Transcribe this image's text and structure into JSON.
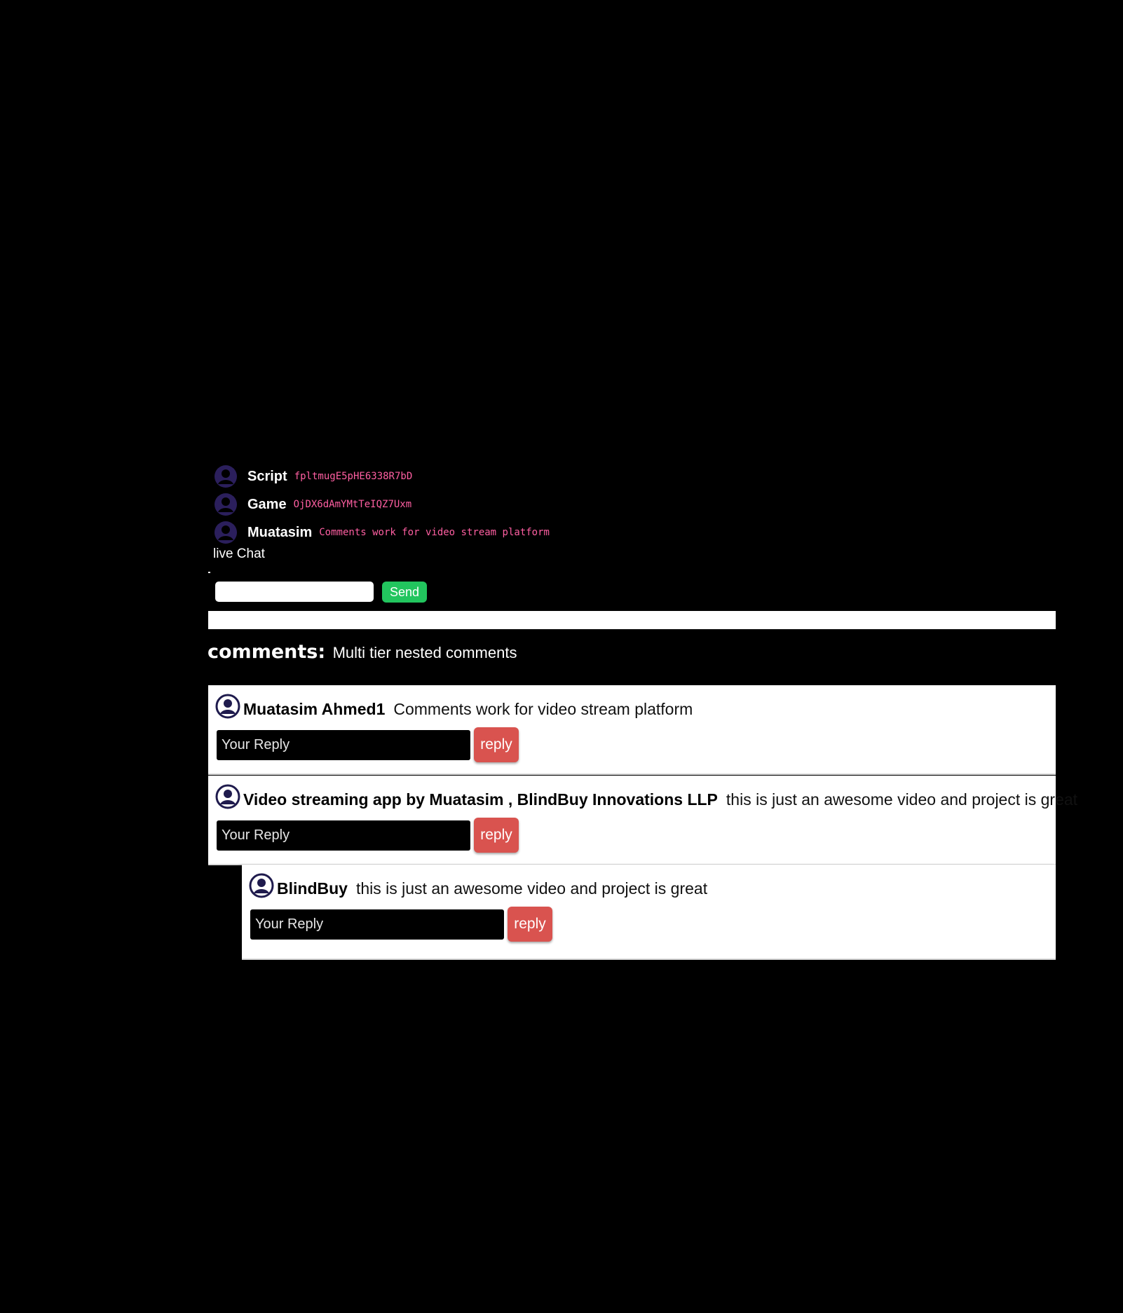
{
  "live_chat": {
    "messages": [
      {
        "user": "Script",
        "text": "fpltmugE5pHE6338R7bD",
        "avatar_icon": "user-circle-icon"
      },
      {
        "user": "Game",
        "text": "OjDX6dAmYMtTeIQZ7Uxm",
        "avatar_icon": "user-circle-icon"
      },
      {
        "user": "Muatasim",
        "text": "Comments work for video stream platform",
        "avatar_icon": "user-circle-icon"
      }
    ],
    "title": "live Chat",
    "input_value": "",
    "send_label": "Send"
  },
  "comments": {
    "heading_label": "comments:",
    "heading_text": "Multi tier nested comments",
    "items": [
      {
        "author": "Muatasim Ahmed1",
        "text": "Comments work for video stream platform",
        "reply_placeholder": "Your Reply",
        "reply_label": "reply",
        "depth": 0
      },
      {
        "author": "Video streaming app by Muatasim , BlindBuy Innovations LLP",
        "text": "this is just an awesome video and project is great",
        "reply_placeholder": "Your Reply",
        "reply_label": "reply",
        "depth": 0
      },
      {
        "author": "BlindBuy",
        "text": "this is just an awesome video and project is great",
        "reply_placeholder": "Your Reply",
        "reply_label": "reply",
        "depth": 1
      }
    ]
  },
  "colors": {
    "background": "#000000",
    "chat_avatar": "#2b1f5c",
    "comment_avatar": "#1f1b4d",
    "chat_text": "#ff5fa2",
    "send_button": "#22c55e",
    "reply_button": "#d9534f"
  }
}
